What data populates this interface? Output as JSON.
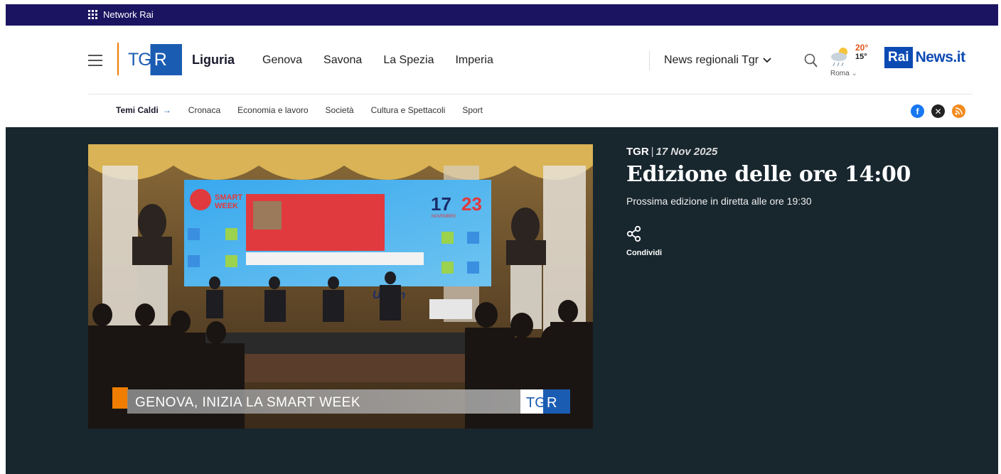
{
  "network_bar": {
    "label": "Network Rai"
  },
  "header": {
    "logo_t": "TG",
    "logo_r": "R",
    "region": "Liguria",
    "nav": [
      "Genova",
      "Savona",
      "La Spezia",
      "Imperia"
    ],
    "news_regionali": "News regionali Tgr",
    "weather": {
      "high": "20°",
      "low": "15°",
      "city": "Roma"
    },
    "brand_rai": "Rai",
    "brand_news": "News.it"
  },
  "subnav": {
    "hot_label": "Temi Caldi",
    "hot_arrow": "→",
    "items": [
      "Cronaca",
      "Economia e lavoro",
      "Società",
      "Cultura e Spettacoli",
      "Sport"
    ]
  },
  "hero": {
    "source": "TGR",
    "separator": "|",
    "date": "17 Nov 2025",
    "title": "Edizione delle ore 14:00",
    "next_edition": "Prossima edizione in diretta alle ore 19:30",
    "share_label": "Condividi",
    "video": {
      "lower_third": "GENOVA, INIZIA LA SMART WEEK",
      "badge_t": "TG",
      "badge_r": "R",
      "screen_title_a": "SMART",
      "screen_title_b": "WEEK",
      "screen_days_a": "17",
      "screen_days_b": "23",
      "screen_month": "NOVEMBRE",
      "screen_banner": "Urban"
    }
  },
  "colors": {
    "network_bar": "#1b1460",
    "hero_bg": "#18262e",
    "accent_orange": "#f07d00",
    "brand_blue": "#1b5cb3"
  }
}
